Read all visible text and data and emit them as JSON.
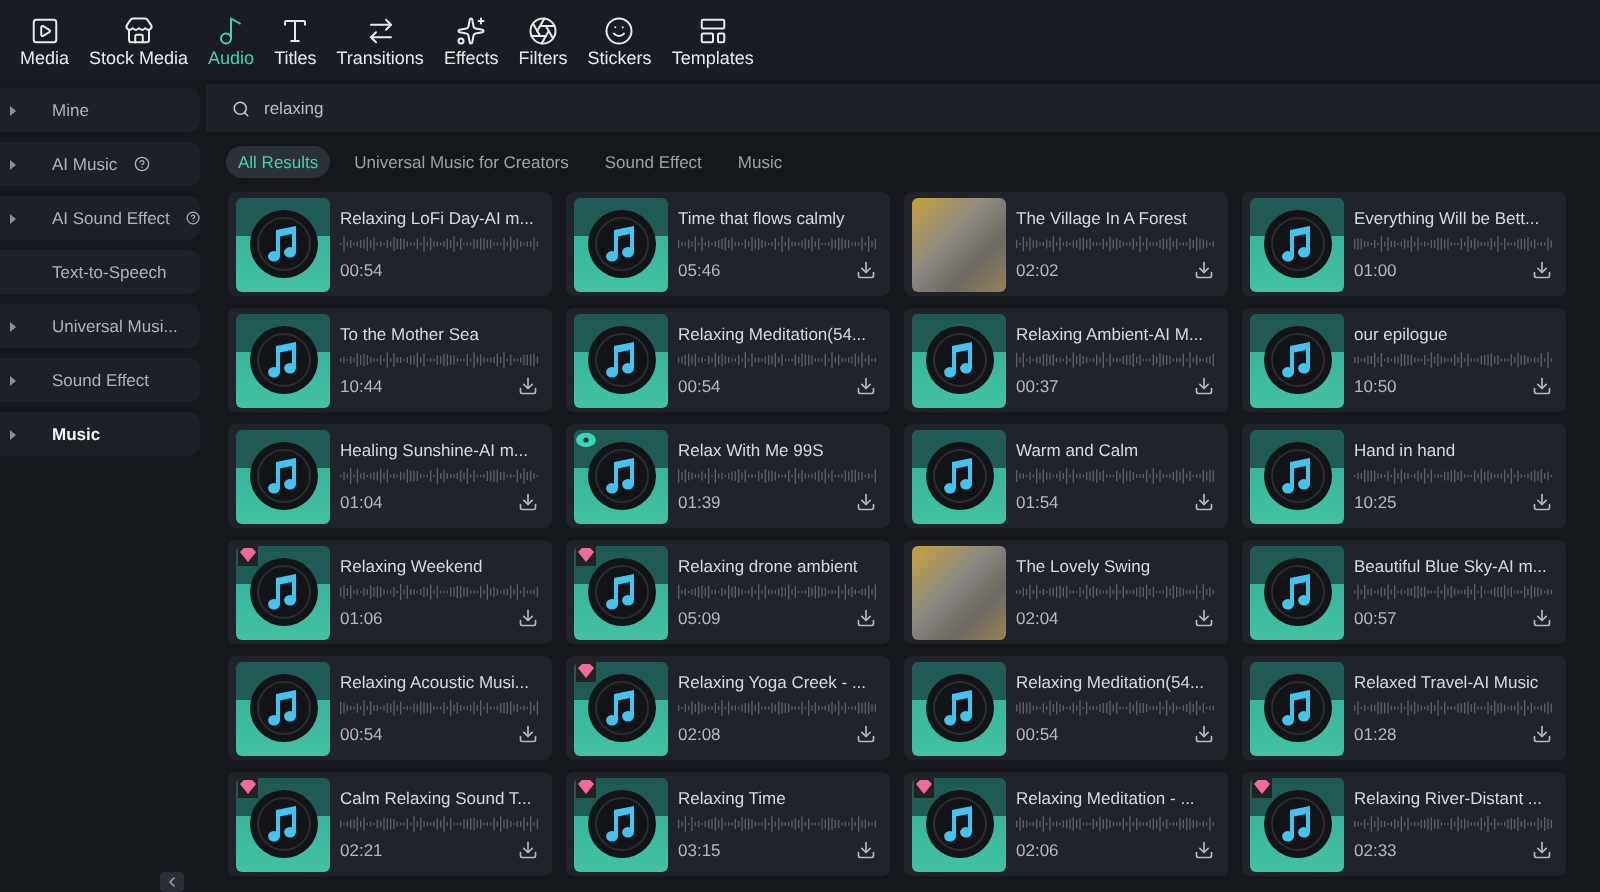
{
  "toolbar": [
    {
      "label": "Media",
      "selected": false
    },
    {
      "label": "Stock Media",
      "selected": false
    },
    {
      "label": "Audio",
      "selected": true
    },
    {
      "label": "Titles",
      "selected": false
    },
    {
      "label": "Transitions",
      "selected": false
    },
    {
      "label": "Effects",
      "selected": false
    },
    {
      "label": "Filters",
      "selected": false
    },
    {
      "label": "Stickers",
      "selected": false
    },
    {
      "label": "Templates",
      "selected": false
    }
  ],
  "sidebar": {
    "items": [
      {
        "label": "Mine",
        "expandable": true,
        "help": false,
        "selected": false
      },
      {
        "label": "AI Music",
        "expandable": true,
        "help": true,
        "selected": false
      },
      {
        "label": "AI Sound Effect",
        "expandable": true,
        "help": true,
        "selected": false
      },
      {
        "label": "Text-to-Speech",
        "expandable": false,
        "help": false,
        "selected": false
      },
      {
        "label": "Universal Musi...",
        "expandable": true,
        "help": false,
        "selected": false
      },
      {
        "label": "Sound Effect",
        "expandable": true,
        "help": false,
        "selected": false
      },
      {
        "label": "Music",
        "expandable": true,
        "help": false,
        "selected": true
      }
    ]
  },
  "search": {
    "value": "relaxing"
  },
  "filters": [
    {
      "label": "All Results",
      "selected": true
    },
    {
      "label": "Universal Music for Creators",
      "selected": false
    },
    {
      "label": "Sound Effect",
      "selected": false
    },
    {
      "label": "Music",
      "selected": false
    }
  ],
  "tracks": [
    {
      "title": "Relaxing LoFi Day-AI m...",
      "duration": "00:54",
      "kind": "music",
      "premium": false,
      "tagged": false,
      "download": false
    },
    {
      "title": "Time that flows calmly",
      "duration": "05:46",
      "kind": "music",
      "premium": false,
      "tagged": false,
      "download": true
    },
    {
      "title": "The Village In A Forest",
      "duration": "02:02",
      "kind": "photo",
      "premium": false,
      "tagged": false,
      "download": true
    },
    {
      "title": "Everything Will be Bett...",
      "duration": "01:00",
      "kind": "music",
      "premium": false,
      "tagged": false,
      "download": true
    },
    {
      "title": "To the Mother Sea",
      "duration": "10:44",
      "kind": "music",
      "premium": false,
      "tagged": false,
      "download": true
    },
    {
      "title": "Relaxing Meditation(54...",
      "duration": "00:54",
      "kind": "music",
      "premium": false,
      "tagged": false,
      "download": true
    },
    {
      "title": "Relaxing Ambient-AI M...",
      "duration": "00:37",
      "kind": "music",
      "premium": false,
      "tagged": false,
      "download": true
    },
    {
      "title": "our epilogue",
      "duration": "10:50",
      "kind": "music",
      "premium": false,
      "tagged": false,
      "download": true
    },
    {
      "title": "Healing Sunshine-AI m...",
      "duration": "01:04",
      "kind": "music",
      "premium": false,
      "tagged": false,
      "download": true
    },
    {
      "title": "Relax With Me 99S",
      "duration": "01:39",
      "kind": "music",
      "premium": false,
      "tagged": true,
      "download": true
    },
    {
      "title": "Warm and Calm",
      "duration": "01:54",
      "kind": "music",
      "premium": false,
      "tagged": false,
      "download": true
    },
    {
      "title": "Hand in hand",
      "duration": "10:25",
      "kind": "music",
      "premium": false,
      "tagged": false,
      "download": true
    },
    {
      "title": "Relaxing Weekend",
      "duration": "01:06",
      "kind": "music",
      "premium": true,
      "tagged": false,
      "download": true
    },
    {
      "title": "Relaxing drone ambient",
      "duration": "05:09",
      "kind": "music",
      "premium": true,
      "tagged": false,
      "download": true
    },
    {
      "title": "The Lovely Swing",
      "duration": "02:04",
      "kind": "photo",
      "premium": false,
      "tagged": false,
      "download": true
    },
    {
      "title": "Beautiful Blue Sky-AI m...",
      "duration": "00:57",
      "kind": "music",
      "premium": false,
      "tagged": false,
      "download": true
    },
    {
      "title": "Relaxing Acoustic Musi...",
      "duration": "00:54",
      "kind": "music",
      "premium": false,
      "tagged": false,
      "download": true
    },
    {
      "title": "Relaxing Yoga Creek - ...",
      "duration": "02:08",
      "kind": "music",
      "premium": true,
      "tagged": false,
      "download": true
    },
    {
      "title": "Relaxing Meditation(54...",
      "duration": "00:54",
      "kind": "music",
      "premium": false,
      "tagged": false,
      "download": true
    },
    {
      "title": "Relaxed Travel-AI Music",
      "duration": "01:28",
      "kind": "music",
      "premium": false,
      "tagged": false,
      "download": true
    },
    {
      "title": "Calm Relaxing Sound T...",
      "duration": "02:21",
      "kind": "music",
      "premium": true,
      "tagged": false,
      "download": true
    },
    {
      "title": "Relaxing Time",
      "duration": "03:15",
      "kind": "music",
      "premium": true,
      "tagged": false,
      "download": true
    },
    {
      "title": "Relaxing Meditation - ...",
      "duration": "02:06",
      "kind": "music",
      "premium": true,
      "tagged": false,
      "download": true
    },
    {
      "title": "Relaxing River-Distant ...",
      "duration": "02:33",
      "kind": "music",
      "premium": true,
      "tagged": false,
      "download": true
    }
  ]
}
